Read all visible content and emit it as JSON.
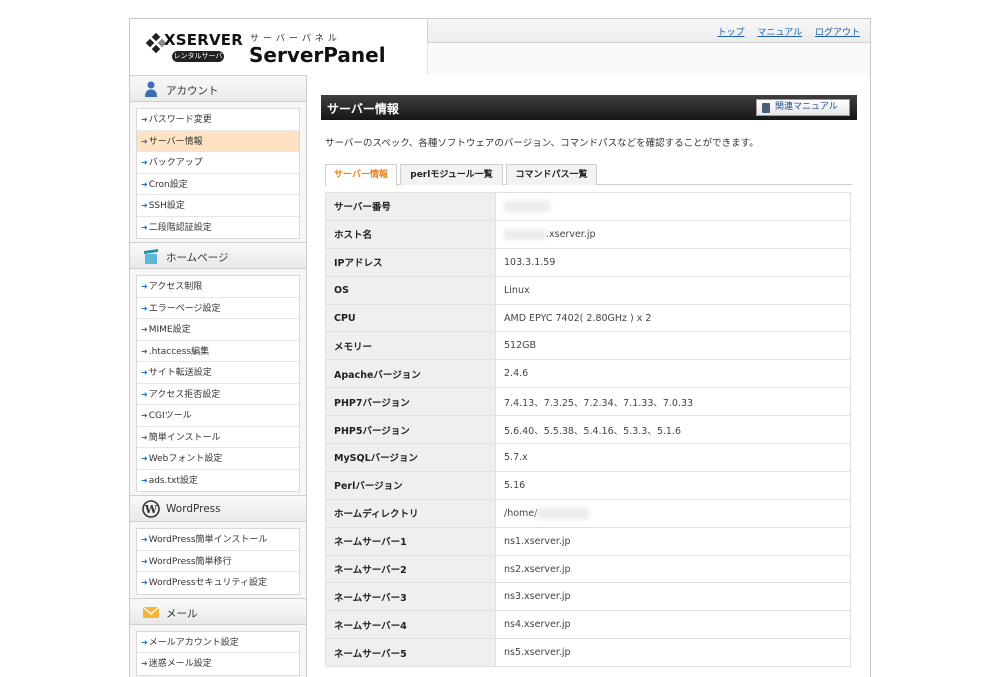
{
  "header": {
    "brand_name": "XSERVER",
    "brand_sub": "レンタルサーバー",
    "panel_kana": "サーバーパネル",
    "panel_name": "ServerPanel",
    "links": [
      "トップ",
      "マニュアル",
      "ログアウト"
    ]
  },
  "sidebar": {
    "sections": [
      {
        "title": "アカウント",
        "icon": "person-icon",
        "items": [
          "パスワード変更",
          "サーバー情報",
          "バックアップ",
          "Cron設定",
          "SSH設定",
          "二段階認証設定"
        ]
      },
      {
        "title": "ホームページ",
        "icon": "box-icon",
        "items": [
          "アクセス制限",
          "エラーページ設定",
          "MIME設定",
          ".htaccess編集",
          "サイト転送設定",
          "アクセス拒否設定",
          "CGIツール",
          "簡単インストール",
          "Webフォント設定",
          "ads.txt設定"
        ]
      },
      {
        "title": "WordPress",
        "icon": "wordpress-icon",
        "items": [
          "WordPress簡単インストール",
          "WordPress簡単移行",
          "WordPressセキュリティ設定"
        ]
      },
      {
        "title": "メール",
        "icon": "envelope-icon",
        "items": [
          "メールアカウント設定",
          "迷惑メール設定"
        ]
      }
    ],
    "active_item": "サーバー情報"
  },
  "main": {
    "title": "サーバー情報",
    "manual_button": "関連マニュアル",
    "description": "サーバーのスペック、各種ソフトウェアのバージョン、コマンドパスなどを確認することができます。",
    "tabs": [
      "サーバー情報",
      "perlモジュール一覧",
      "コマンドパス一覧"
    ],
    "active_tab": "サーバー情報",
    "rows": [
      {
        "key": "サーバー番号",
        "value": ""
      },
      {
        "key": "ホスト名",
        "value": ".xserver.jp"
      },
      {
        "key": "IPアドレス",
        "value": "103.3.1.59"
      },
      {
        "key": "OS",
        "value": "Linux"
      },
      {
        "key": "CPU",
        "value": "AMD EPYC 7402( 2.80GHz ) x 2"
      },
      {
        "key": "メモリー",
        "value": "512GB"
      },
      {
        "key": "Apacheバージョン",
        "value": "2.4.6"
      },
      {
        "key": "PHP7バージョン",
        "value": "7.4.13、7.3.25、7.2.34、7.1.33、7.0.33"
      },
      {
        "key": "PHP5バージョン",
        "value": "5.6.40、5.5.38、5.4.16、5.3.3、5.1.6"
      },
      {
        "key": "MySQLバージョン",
        "value": "5.7.x"
      },
      {
        "key": "Perlバージョン",
        "value": "5.16"
      },
      {
        "key": "ホームディレクトリ",
        "value": "/home/"
      },
      {
        "key": "ネームサーバー1",
        "value": "ns1.xserver.jp"
      },
      {
        "key": "ネームサーバー2",
        "value": "ns2.xserver.jp"
      },
      {
        "key": "ネームサーバー3",
        "value": "ns3.xserver.jp"
      },
      {
        "key": "ネームサーバー4",
        "value": "ns4.xserver.jp"
      },
      {
        "key": "ネームサーバー5",
        "value": "ns5.xserver.jp"
      }
    ]
  }
}
